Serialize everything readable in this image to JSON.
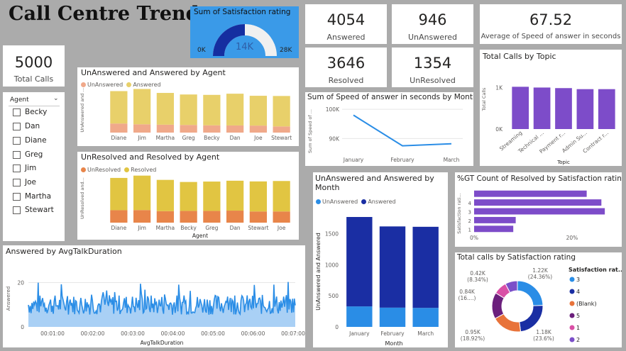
{
  "header": {
    "title": "Call Centre Trends"
  },
  "gauge": {
    "title": "Sum of Satisfaction rating",
    "min": "0K",
    "max": "28K",
    "value": "14K",
    "fraction": 0.5
  },
  "kpis": {
    "answered": {
      "value": "4054",
      "label": "Answered"
    },
    "unanswered": {
      "value": "946",
      "label": "UnAnswered"
    },
    "speed": {
      "value": "67.52",
      "label": "Average of Speed of answer in seconds"
    },
    "resolved": {
      "value": "3646",
      "label": "Resolved"
    },
    "unresolved": {
      "value": "1354",
      "label": "UnResolved"
    },
    "total": {
      "value": "5000",
      "label": "Total Calls"
    }
  },
  "slicer": {
    "header": "Agent",
    "items": [
      "Becky",
      "Dan",
      "Diane",
      "Greg",
      "Jim",
      "Joe",
      "Martha",
      "Stewart"
    ]
  },
  "colors": {
    "salmon": "#f0a98a",
    "gold": "#e8d06a",
    "orange": "#e8854a",
    "mustard": "#e1c542",
    "blue": "#2a8de6",
    "navy": "#1a2ea3",
    "purple": "#7d4cc9",
    "gaugeNavy": "#152ea0",
    "gaugeBg": "#3a9ae8"
  },
  "chart_data": [
    {
      "id": "unans_ans_agent",
      "type": "bar",
      "title": "UnAnswered and Answered by Agent",
      "ylabel": "UnAnswered and ...",
      "categories": [
        "Diane",
        "Jim",
        "Martha",
        "Greg",
        "Becky",
        "Dan",
        "Joe",
        "Stewart"
      ],
      "series": [
        {
          "name": "UnAnswered",
          "values": [
            140,
            128,
            122,
            118,
            112,
            110,
            108,
            95
          ]
        },
        {
          "name": "Answered",
          "values": [
            500,
            545,
            490,
            470,
            470,
            490,
            460,
            470
          ]
        }
      ],
      "ylim": [
        0,
        700
      ]
    },
    {
      "id": "unres_res_agent",
      "type": "bar",
      "title": "UnResolved and Resolved by Agent",
      "ylabel": "UnResolved and...",
      "xlabel": "Agent",
      "categories": [
        "Diane",
        "Jim",
        "Martha",
        "Becky",
        "Greg",
        "Dan",
        "Stewart",
        "Joe"
      ],
      "series": [
        {
          "name": "UnResolved",
          "values": [
            178,
            180,
            165,
            168,
            168,
            172,
            160,
            160
          ]
        },
        {
          "name": "Resolved",
          "values": [
            462,
            493,
            447,
            414,
            420,
            428,
            430,
            436
          ]
        }
      ],
      "ylim": [
        0,
        700
      ]
    },
    {
      "id": "speed_month",
      "type": "line",
      "title": "Sum of Speed of answer in seconds by Month",
      "ylabel": "Sum of Speed of ...",
      "x": [
        "January",
        "February",
        "March"
      ],
      "values": [
        98000,
        87500,
        88200
      ],
      "yticks": [
        "100K",
        "90K"
      ],
      "ylim": [
        84000,
        101500
      ]
    },
    {
      "id": "topic",
      "type": "bar",
      "title": "Total Calls by Topic",
      "ylabel": "Total Calls",
      "xlabel": "Topic",
      "categories": [
        "Streaming",
        "Technical ...",
        "Payment r...",
        "Admin Su...",
        "Contract r..."
      ],
      "values": [
        1022,
        1004,
        990,
        965,
        965
      ],
      "yticks": [
        "1K",
        "0K"
      ],
      "ylim": [
        0,
        1200
      ]
    },
    {
      "id": "unans_ans_month",
      "type": "bar",
      "title": "UnAnswered and Answered by Month",
      "ylabel": "UnAnswered and Answered",
      "xlabel": "Month",
      "categories": [
        "January",
        "February",
        "March"
      ],
      "series": [
        {
          "name": "UnAnswered",
          "values": [
            330,
            310,
            306
          ]
        },
        {
          "name": "Answered",
          "values": [
            1440,
            1308,
            1306
          ]
        }
      ],
      "yticks": [
        "1500",
        "1000",
        "500",
        "0"
      ],
      "ylim": [
        0,
        1850
      ]
    },
    {
      "id": "gt_resolved",
      "type": "bar",
      "title": "%GT Count of Resolved by Satisfaction rating",
      "ylabel": "Satisfaction rati...",
      "categories": [
        "",
        "4",
        "3",
        "2",
        "1"
      ],
      "values": [
        23,
        26,
        26.7,
        8.5,
        8
      ],
      "xticks": [
        "0%",
        "20%"
      ],
      "xlim": [
        0,
        29
      ]
    },
    {
      "id": "satisfaction_donut",
      "type": "pie",
      "title": "Total calls by Satisfaction rating",
      "legend_title": "Satisfaction rat...",
      "series": [
        {
          "name": "3",
          "value": 1.22,
          "label": "1.22K",
          "pct": "(24.36%)",
          "color": "#2a8de6"
        },
        {
          "name": "4",
          "value": 1.18,
          "label": "1.18K",
          "pct": "(23.6%)",
          "color": "#1a2ea3"
        },
        {
          "name": "(Blank)",
          "value": 0.95,
          "label": "0.95K",
          "pct": "(18.92%)",
          "color": "#e8733a"
        },
        {
          "name": "5",
          "value": 0.84,
          "label": "0.84K",
          "pct": "(16....)",
          "color": "#6b1f7c"
        },
        {
          "name": "1",
          "value": 0.42,
          "label": "0.42K",
          "pct": "(8.34%)",
          "color": "#d94fa6"
        },
        {
          "name": "2",
          "value": 0.39,
          "label": "",
          "pct": "",
          "color": "#7b4fc9"
        }
      ]
    },
    {
      "id": "talk_duration",
      "type": "area",
      "title": "Answered by AvgTalkDuration",
      "ylabel": "Answered",
      "xlabel": "AvgTalkDuration",
      "xticks": [
        "00:01:00",
        "00:02:00",
        "00:03:00",
        "00:04:00",
        "00:05:00",
        "00:06:00",
        "00:07:00"
      ],
      "yticks": [
        "20",
        "0"
      ],
      "ylim": [
        0,
        24
      ],
      "approx_mean": 10
    }
  ]
}
